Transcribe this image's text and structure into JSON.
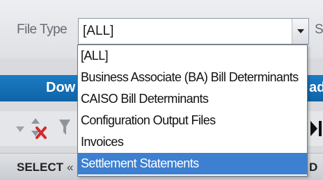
{
  "filter": {
    "label": "File Type",
    "selected_value": "[ALL]",
    "cut_label": "S"
  },
  "dropdown": {
    "options": [
      {
        "label": "[ALL]"
      },
      {
        "label": "Business Associate (BA) Bill Determinants"
      },
      {
        "label": "CAISO Bill Determinants"
      },
      {
        "label": "Configuration Output Files"
      },
      {
        "label": "Invoices"
      },
      {
        "label": "Settlement Statements"
      }
    ],
    "highlighted": "Settlement Statements"
  },
  "action_bar": {
    "left_label": "Dow",
    "right_label": "ad"
  },
  "toolbar": {
    "icons": [
      "triangle-down-icon",
      "clear-sort-icon",
      "filter-icon",
      "last-page-icon"
    ]
  },
  "table_header": {
    "select_label": "SELECT",
    "prev_label": "«",
    "right_col_label": "D"
  },
  "colors": {
    "accent_blue": "#1b7bc3",
    "highlight": "#3d7fd0",
    "clear_red": "#d12a2a"
  }
}
